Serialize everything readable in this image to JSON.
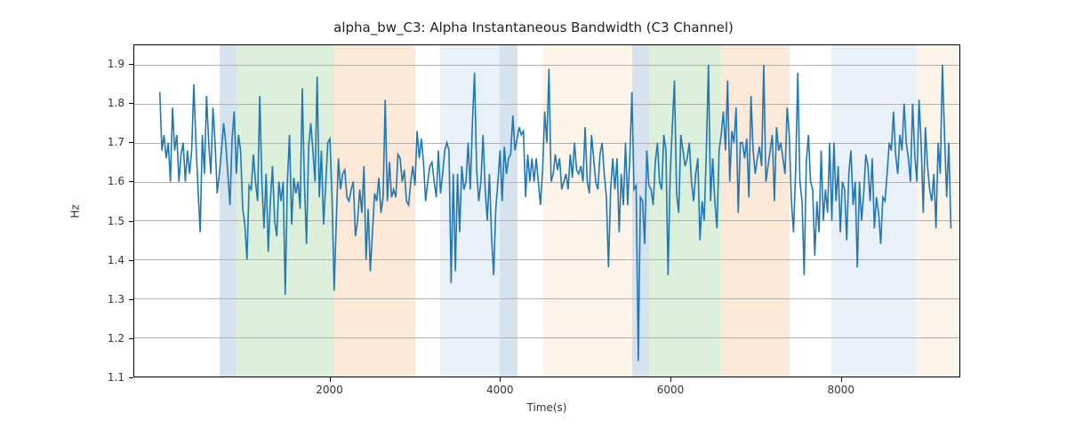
{
  "chart_data": {
    "type": "line",
    "title": "alpha_bw_C3: Alpha Instantaneous Bandwidth (C3 Channel)",
    "xlabel": "Time(s)",
    "ylabel": "Hz",
    "xlim": [
      -300,
      9400
    ],
    "ylim": [
      1.1,
      1.95
    ],
    "xticks": [
      2000,
      4000,
      6000,
      8000
    ],
    "yticks": [
      1.1,
      1.2,
      1.3,
      1.4,
      1.5,
      1.6,
      1.7,
      1.8,
      1.9
    ],
    "line_color": "#1f77b4",
    "bands": [
      {
        "x0": 700,
        "x1": 900,
        "color": "#5a8fbf"
      },
      {
        "x0": 900,
        "x1": 2050,
        "color": "#6fbf6f"
      },
      {
        "x0": 2050,
        "x1": 3000,
        "color": "#f5a25d"
      },
      {
        "x0": 3300,
        "x1": 4000,
        "color": "#aac4e0"
      },
      {
        "x0": 4000,
        "x1": 4200,
        "color": "#5a8fbf"
      },
      {
        "x0": 4500,
        "x1": 5550,
        "color": "#f9d2a8"
      },
      {
        "x0": 5550,
        "x1": 5750,
        "color": "#5a8fbf"
      },
      {
        "x0": 5750,
        "x1": 6600,
        "color": "#6fbf6f"
      },
      {
        "x0": 6600,
        "x1": 7400,
        "color": "#f5a25d"
      },
      {
        "x0": 7900,
        "x1": 8100,
        "color": "#aac4e0"
      },
      {
        "x0": 8100,
        "x1": 8900,
        "color": "#aac4e0"
      },
      {
        "x0": 8900,
        "x1": 9400,
        "color": "#f9d2a8"
      }
    ],
    "x": [
      0,
      25,
      50,
      75,
      100,
      125,
      150,
      175,
      200,
      225,
      250,
      275,
      300,
      325,
      350,
      375,
      400,
      425,
      450,
      475,
      500,
      525,
      550,
      575,
      600,
      625,
      650,
      675,
      700,
      725,
      750,
      775,
      800,
      825,
      850,
      875,
      900,
      925,
      950,
      975,
      1000,
      1025,
      1050,
      1075,
      1100,
      1125,
      1150,
      1175,
      1200,
      1225,
      1250,
      1275,
      1300,
      1325,
      1350,
      1375,
      1400,
      1425,
      1450,
      1475,
      1500,
      1525,
      1550,
      1575,
      1600,
      1625,
      1650,
      1675,
      1700,
      1725,
      1750,
      1775,
      1800,
      1825,
      1850,
      1875,
      1900,
      1925,
      1950,
      1975,
      2000,
      2025,
      2050,
      2075,
      2100,
      2125,
      2150,
      2175,
      2200,
      2225,
      2250,
      2275,
      2300,
      2325,
      2350,
      2375,
      2400,
      2425,
      2450,
      2475,
      2500,
      2525,
      2550,
      2575,
      2600,
      2625,
      2650,
      2675,
      2700,
      2725,
      2750,
      2775,
      2800,
      2825,
      2850,
      2875,
      2900,
      2925,
      2950,
      2975,
      3000,
      3025,
      3050,
      3075,
      3100,
      3125,
      3150,
      3175,
      3200,
      3225,
      3250,
      3275,
      3300,
      3325,
      3350,
      3375,
      3400,
      3425,
      3450,
      3475,
      3500,
      3525,
      3550,
      3575,
      3600,
      3625,
      3650,
      3675,
      3700,
      3725,
      3750,
      3775,
      3800,
      3825,
      3850,
      3875,
      3900,
      3925,
      3950,
      3975,
      4000,
      4025,
      4050,
      4075,
      4100,
      4125,
      4150,
      4175,
      4200,
      4225,
      4250,
      4275,
      4300,
      4325,
      4350,
      4375,
      4400,
      4425,
      4450,
      4475,
      4500,
      4525,
      4550,
      4575,
      4600,
      4625,
      4650,
      4675,
      4700,
      4725,
      4750,
      4775,
      4800,
      4825,
      4850,
      4875,
      4900,
      4925,
      4950,
      4975,
      5000,
      5025,
      5050,
      5075,
      5100,
      5125,
      5150,
      5175,
      5200,
      5225,
      5250,
      5275,
      5300,
      5325,
      5350,
      5375,
      5400,
      5425,
      5450,
      5475,
      5500,
      5525,
      5550,
      5575,
      5600,
      5625,
      5650,
      5675,
      5700,
      5725,
      5750,
      5775,
      5800,
      5825,
      5850,
      5875,
      5900,
      5925,
      5950,
      5975,
      6000,
      6025,
      6050,
      6075,
      6100,
      6125,
      6150,
      6175,
      6200,
      6225,
      6250,
      6275,
      6300,
      6325,
      6350,
      6375,
      6400,
      6425,
      6450,
      6475,
      6500,
      6525,
      6550,
      6575,
      6600,
      6625,
      6650,
      6675,
      6700,
      6725,
      6750,
      6775,
      6800,
      6825,
      6850,
      6875,
      6900,
      6925,
      6950,
      6975,
      7000,
      7025,
      7050,
      7075,
      7100,
      7125,
      7150,
      7175,
      7200,
      7225,
      7250,
      7275,
      7300,
      7325,
      7350,
      7375,
      7400,
      7425,
      7450,
      7475,
      7500,
      7525,
      7550,
      7575,
      7600,
      7625,
      7650,
      7675,
      7700,
      7725,
      7750,
      7775,
      7800,
      7825,
      7850,
      7875,
      7900,
      7925,
      7950,
      7975,
      8000,
      8025,
      8050,
      8075,
      8100,
      8125,
      8150,
      8175,
      8200,
      8225,
      8250,
      8275,
      8300,
      8325,
      8350,
      8375,
      8400,
      8425,
      8450,
      8475,
      8500,
      8525,
      8550,
      8575,
      8600,
      8625,
      8650,
      8675,
      8700,
      8725,
      8750,
      8775,
      8800,
      8825,
      8850,
      8875,
      8900,
      8925,
      8950,
      8975,
      9000,
      9025,
      9050,
      9075,
      9100,
      9125,
      9150,
      9175,
      9200,
      9225,
      9250,
      9275,
      9300
    ],
    "y": [
      1.83,
      1.68,
      1.72,
      1.66,
      1.7,
      1.6,
      1.79,
      1.68,
      1.72,
      1.6,
      1.67,
      1.7,
      1.6,
      1.68,
      1.62,
      1.68,
      1.85,
      1.7,
      1.58,
      1.47,
      1.72,
      1.62,
      1.82,
      1.7,
      1.62,
      1.79,
      1.7,
      1.57,
      1.62,
      1.68,
      1.75,
      1.7,
      1.62,
      1.54,
      1.71,
      1.78,
      1.62,
      1.72,
      1.68,
      1.53,
      1.49,
      1.4,
      1.59,
      1.58,
      1.67,
      1.6,
      1.55,
      1.82,
      1.6,
      1.48,
      1.62,
      1.42,
      1.55,
      1.64,
      1.5,
      1.46,
      1.6,
      1.55,
      1.6,
      1.31,
      1.6,
      1.72,
      1.49,
      1.61,
      1.57,
      1.6,
      1.53,
      1.84,
      1.6,
      1.44,
      1.69,
      1.75,
      1.68,
      1.6,
      1.87,
      1.56,
      1.68,
      1.49,
      1.59,
      1.7,
      1.71,
      1.56,
      1.32,
      1.5,
      1.66,
      1.58,
      1.62,
      1.63,
      1.56,
      1.55,
      1.58,
      1.6,
      1.46,
      1.5,
      1.58,
      1.52,
      1.64,
      1.4,
      1.53,
      1.37,
      1.47,
      1.57,
      1.55,
      1.61,
      1.52,
      1.56,
      1.81,
      1.55,
      1.65,
      1.56,
      1.58,
      1.56,
      1.67,
      1.66,
      1.6,
      1.63,
      1.55,
      1.54,
      1.6,
      1.64,
      1.59,
      1.73,
      1.66,
      1.71,
      1.65,
      1.55,
      1.6,
      1.64,
      1.65,
      1.6,
      1.56,
      1.68,
      1.57,
      1.62,
      1.68,
      1.7,
      1.68,
      1.34,
      1.62,
      1.37,
      1.62,
      1.47,
      1.64,
      1.58,
      1.6,
      1.7,
      1.58,
      1.75,
      1.88,
      1.63,
      1.55,
      1.6,
      1.72,
      1.58,
      1.5,
      1.62,
      1.46,
      1.36,
      1.53,
      1.6,
      1.68,
      1.55,
      1.69,
      1.62,
      1.66,
      1.67,
      1.77,
      1.68,
      1.71,
      1.74,
      1.72,
      1.73,
      1.56,
      1.67,
      1.6,
      1.66,
      1.6,
      1.66,
      1.6,
      1.54,
      1.63,
      1.78,
      1.7,
      1.89,
      1.6,
      1.62,
      1.67,
      1.63,
      1.66,
      1.58,
      1.6,
      1.62,
      1.58,
      1.67,
      1.61,
      1.7,
      1.63,
      1.62,
      1.64,
      1.6,
      1.74,
      1.6,
      1.57,
      1.72,
      1.66,
      1.6,
      1.58,
      1.67,
      1.7,
      1.62,
      1.56,
      1.38,
      1.58,
      1.66,
      1.58,
      1.66,
      1.47,
      1.62,
      1.54,
      1.7,
      1.54,
      1.66,
      1.83,
      1.58,
      1.59,
      1.14,
      1.56,
      1.55,
      1.44,
      1.68,
      1.59,
      1.58,
      1.54,
      1.65,
      1.7,
      1.6,
      1.58,
      1.72,
      1.68,
      1.36,
      1.62,
      1.74,
      1.86,
      1.57,
      1.52,
      1.72,
      1.68,
      1.64,
      1.66,
      1.7,
      1.6,
      1.55,
      1.62,
      1.66,
      1.45,
      1.55,
      1.5,
      1.68,
      1.9,
      1.55,
      1.66,
      1.55,
      1.48,
      1.68,
      1.72,
      1.78,
      1.68,
      1.86,
      1.6,
      1.73,
      1.7,
      1.79,
      1.52,
      1.7,
      1.7,
      1.66,
      1.71,
      1.56,
      1.82,
      1.68,
      1.62,
      1.66,
      1.69,
      1.64,
      1.9,
      1.6,
      1.64,
      1.68,
      1.72,
      1.55,
      1.74,
      1.68,
      1.7,
      1.66,
      1.62,
      1.79,
      1.72,
      1.55,
      1.47,
      1.63,
      1.88,
      1.6,
      1.55,
      1.36,
      1.65,
      1.72,
      1.6,
      1.58,
      1.41,
      1.55,
      1.47,
      1.68,
      1.5,
      1.58,
      1.52,
      1.7,
      1.5,
      1.7,
      1.55,
      1.64,
      1.47,
      1.6,
      1.58,
      1.45,
      1.62,
      1.68,
      1.54,
      1.6,
      1.38,
      1.6,
      1.5,
      1.57,
      1.67,
      1.64,
      1.55,
      1.66,
      1.48,
      1.56,
      1.52,
      1.44,
      1.56,
      1.55,
      1.62,
      1.7,
      1.68,
      1.78,
      1.67,
      1.62,
      1.72,
      1.68,
      1.8,
      1.7,
      1.66,
      1.6,
      1.8,
      1.67,
      1.6,
      1.81,
      1.7,
      1.52,
      1.74,
      1.64,
      1.58,
      1.55,
      1.62,
      1.48,
      1.7,
      1.62,
      1.9,
      1.72,
      1.56,
      1.7,
      1.48
    ]
  }
}
